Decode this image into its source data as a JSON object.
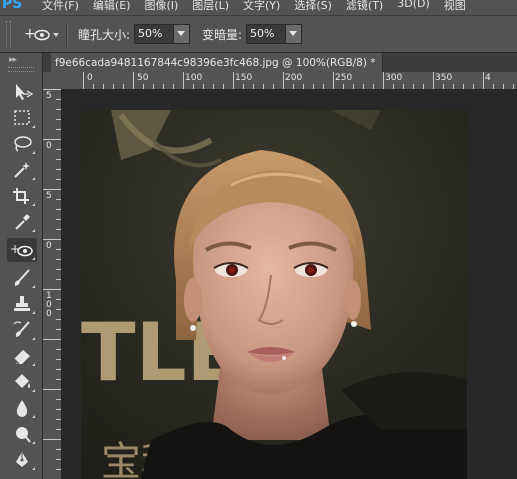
{
  "app": {
    "logo": "PS",
    "menus": [
      "文件(F)",
      "编辑(E)",
      "图像(I)",
      "图层(L)",
      "文字(Y)",
      "选择(S)",
      "滤镜(T)",
      "3D(D)",
      "视图"
    ]
  },
  "options": {
    "pupil_label": "瞳孔大小:",
    "pupil_value": "50%",
    "darken_label": "变暗量:",
    "darken_value": "50%"
  },
  "toolbar": {
    "collapse": "▸▸",
    "tools": [
      "move",
      "marquee",
      "lasso",
      "magic-wand",
      "crop",
      "eyedropper",
      "red-eye",
      "brush",
      "clone-stamp",
      "history-brush",
      "eraser",
      "paint-bucket",
      "blur",
      "dodge",
      "pen"
    ],
    "active_tool": "red-eye"
  },
  "document": {
    "tab_title": "f9e66cada9481167844c98396e3fc468.jpg @ 100%(RGB/8) *"
  },
  "rulers": {
    "horizontal": [
      "0",
      "50",
      "100",
      "150",
      "200",
      "250",
      "300",
      "350",
      "4"
    ],
    "vertical": [
      "5",
      "0",
      "5",
      "0",
      "1 0 0",
      "1 5 0",
      "2 0 0",
      "2 5 0",
      "3 0 0",
      "3 5 0"
    ]
  },
  "photo": {
    "background_text": "TLE",
    "bottom_text": "宝利广"
  },
  "colors": {
    "panel": "#535353",
    "workspace": "#282828",
    "active_tool_bg": "#3a3a3a"
  }
}
